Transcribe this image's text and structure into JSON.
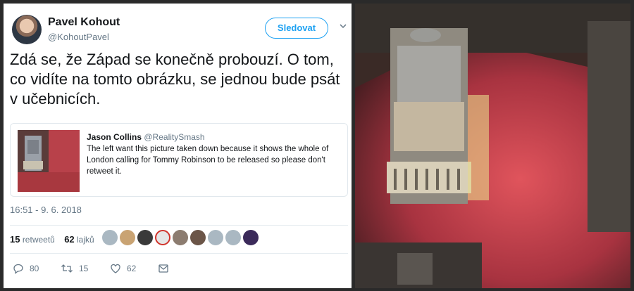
{
  "tweet": {
    "author_name": "Pavel Kohout",
    "author_handle": "@KohoutPavel",
    "follow_label": "Sledovat",
    "text": "Zdá se, že Západ se konečně probouzí. O tom, co vidíte na tomto obrázku, se jednou bude psát v učebnicích.",
    "timestamp": "16:51 - 9. 6. 2018",
    "retweets_count": "15",
    "retweets_label": "retweetů",
    "likes_count": "62",
    "likes_label": "lajků",
    "reply_count": "80",
    "retweet_action_count": "15",
    "like_action_count": "62"
  },
  "quoted": {
    "author_name": "Jason Collins",
    "author_handle": "@RealitySmash",
    "text": "The left want this picture taken down because it shows the whole of London calling for Tommy Robinson to be released so please don't retweet it."
  },
  "colors": {
    "accent": "#1da1f2",
    "secondary_text": "#657786",
    "crowd": "#c8434a"
  },
  "icons": [
    "chevron-down-icon",
    "reply-icon",
    "retweet-icon",
    "like-icon",
    "dm-icon"
  ]
}
